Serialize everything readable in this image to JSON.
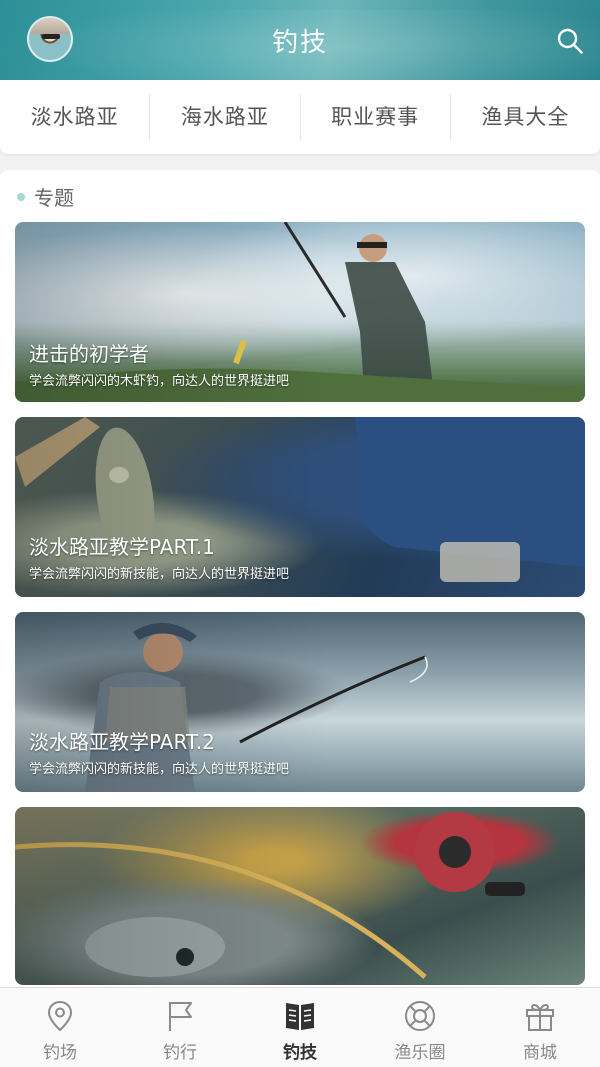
{
  "header": {
    "title": "钓技",
    "avatar_icon": "avatar",
    "search_icon": "search-icon"
  },
  "tabs": [
    {
      "label": "淡水路亚"
    },
    {
      "label": "海水路亚"
    },
    {
      "label": "职业赛事"
    },
    {
      "label": "渔具大全"
    }
  ],
  "section": {
    "title": "专题"
  },
  "cards": [
    {
      "title": "进击的初学者",
      "subtitle": "学会流弊闪闪的木虾钓，向达人的世界挺进吧"
    },
    {
      "title": "淡水路亚教学PART.1",
      "subtitle": "学会流弊闪闪的新技能，向达人的世界挺进吧"
    },
    {
      "title": "淡水路亚教学PART.2",
      "subtitle": "学会流弊闪闪的新技能，向达人的世界挺进吧"
    },
    {
      "title": "",
      "subtitle": ""
    }
  ],
  "bottom_nav": [
    {
      "label": "钓场",
      "icon": "location-pin-icon",
      "active": false
    },
    {
      "label": "钓行",
      "icon": "flag-icon",
      "active": false
    },
    {
      "label": "钓技",
      "icon": "book-icon",
      "active": true
    },
    {
      "label": "渔乐圈",
      "icon": "lifebuoy-icon",
      "active": false
    },
    {
      "label": "商城",
      "icon": "gift-icon",
      "active": false
    }
  ],
  "colors": {
    "header_accent": "#3a9aa1",
    "section_dot": "#a8d8d4",
    "nav_icon": "#8a8a8a",
    "nav_icon_active": "#333333"
  }
}
